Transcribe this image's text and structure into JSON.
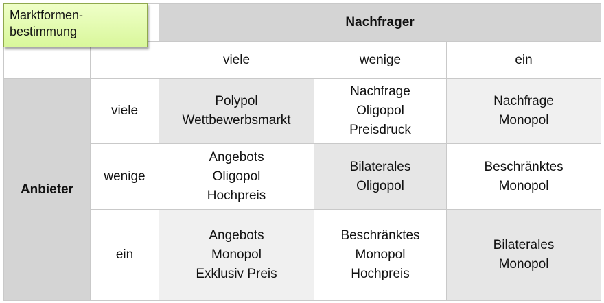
{
  "title_box": [
    "Marktformen-",
    "bestimmung"
  ],
  "nachfrager_header": "Nachfrager",
  "anbieter_header": "Anbieter",
  "columns": [
    "viele",
    "wenige",
    "ein"
  ],
  "rows": [
    {
      "label": "viele",
      "cells": [
        [
          "Polypol",
          "Wettbewerbsmarkt"
        ],
        [
          "Nachfrage",
          "Oligopol",
          "Preisdruck"
        ],
        [
          "Nachfrage",
          "Monopol"
        ]
      ]
    },
    {
      "label": "wenige",
      "cells": [
        [
          "Angebots",
          "Oligopol",
          "Hochpreis"
        ],
        [
          "Bilaterales",
          "Oligopol"
        ],
        [
          "Beschränktes",
          "Monopol"
        ]
      ]
    },
    {
      "label": "ein",
      "cells": [
        [
          "Angebots",
          "Monopol",
          "Exklusiv Preis"
        ],
        [
          "Beschränktes",
          "Monopol",
          "Hochpreis"
        ],
        [
          "Bilaterales",
          "Monopol"
        ]
      ]
    }
  ]
}
